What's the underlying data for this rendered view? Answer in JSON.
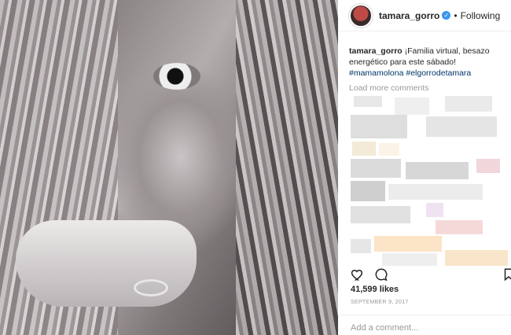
{
  "post": {
    "username": "tamara_gorro",
    "follow_status": "Following",
    "separator": "•",
    "verified_glyph": "✓",
    "caption_user": "tamara_gorro",
    "caption_text": "¡Familia virtual, besazo energético para este sábado!",
    "hashtags": "#mamamolona #elgorrodetamara",
    "load_more": "Load more comments",
    "likes": "41,599 likes",
    "date": "SEPTEMBER 9, 2017",
    "add_comment_placeholder": "Add a comment..."
  },
  "icons": {
    "heart": "heart-icon",
    "comment": "comment-icon",
    "bookmark": "bookmark-icon",
    "verified": "verified-badge-icon"
  },
  "colors": {
    "hashtag": "#003569",
    "verified": "#3897f0",
    "muted": "#999999",
    "text": "#262626"
  }
}
